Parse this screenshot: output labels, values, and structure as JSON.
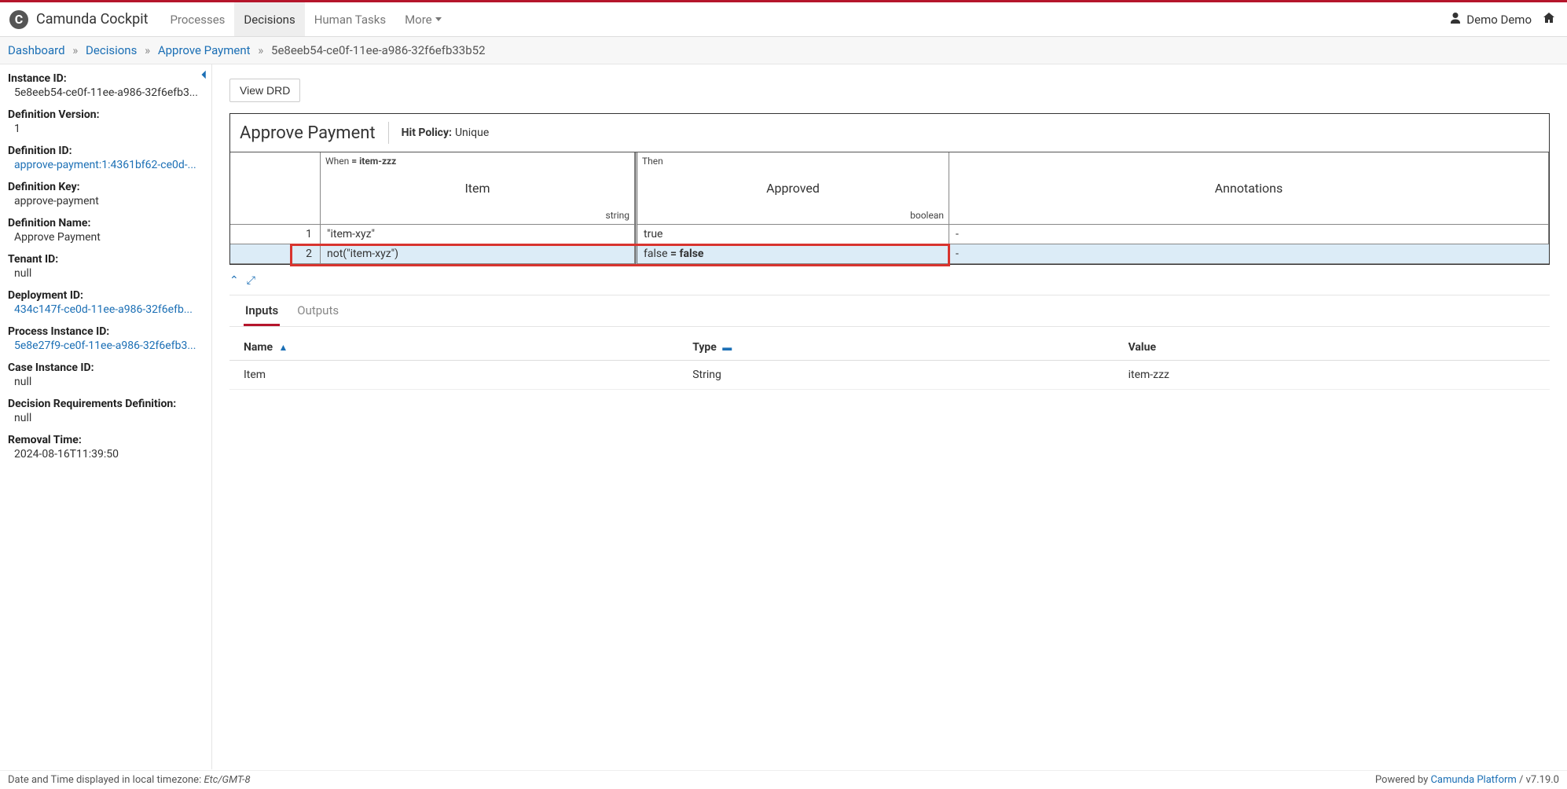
{
  "header": {
    "app_title": "Camunda Cockpit",
    "nav": [
      "Processes",
      "Decisions",
      "Human Tasks",
      "More"
    ],
    "active_nav_index": 1,
    "user_name": "Demo Demo"
  },
  "breadcrumb": {
    "items": [
      {
        "label": "Dashboard",
        "link": true
      },
      {
        "label": "Decisions",
        "link": true
      },
      {
        "label": "Approve Payment",
        "link": true
      },
      {
        "label": "5e8eeb54-ce0f-11ee-a986-32f6efb33b52",
        "link": false
      }
    ]
  },
  "sidebar": {
    "instance_id": {
      "label": "Instance ID:",
      "value": "5e8eeb54-ce0f-11ee-a986-32f6efb3..."
    },
    "definition_version": {
      "label": "Definition Version:",
      "value": "1"
    },
    "definition_id": {
      "label": "Definition ID:",
      "value": "approve-payment:1:4361bf62-ce0d-..."
    },
    "definition_key": {
      "label": "Definition Key:",
      "value": "approve-payment"
    },
    "definition_name": {
      "label": "Definition Name:",
      "value": "Approve Payment"
    },
    "tenant_id": {
      "label": "Tenant ID:",
      "value": "null"
    },
    "deployment_id": {
      "label": "Deployment ID:",
      "value": "434c147f-ce0d-11ee-a986-32f6efb..."
    },
    "process_instance_id": {
      "label": "Process Instance ID:",
      "value": "5e8e27f9-ce0f-11ee-a986-32f6efb3..."
    },
    "case_instance_id": {
      "label": "Case Instance ID:",
      "value": "null"
    },
    "drd": {
      "label": "Decision Requirements Definition:",
      "value": "null"
    },
    "removal_time": {
      "label": "Removal Time:",
      "value": "2024-08-16T11:39:50"
    }
  },
  "actions": {
    "view_drd": "View DRD"
  },
  "dmn": {
    "title": "Approve Payment",
    "hit_policy_label": "Hit Policy:",
    "hit_policy_value": "Unique",
    "columns": {
      "when_label": "When",
      "when_expr": "= item-zzz",
      "input_name": "Item",
      "input_type": "string",
      "then_label": "Then",
      "output_name": "Approved",
      "output_type": "boolean",
      "annotations": "Annotations"
    },
    "rules": [
      {
        "num": "1",
        "input": "\"item-xyz\"",
        "output": "true",
        "annotation": "-",
        "highlighted": false
      },
      {
        "num": "2",
        "input": "not(\"item-xyz\")",
        "output_prefix": "false ",
        "output_bold": "= false",
        "annotation": "-",
        "highlighted": true
      }
    ]
  },
  "tabs": {
    "items": [
      "Inputs",
      "Outputs"
    ],
    "active_index": 0
  },
  "table": {
    "headers": {
      "name": "Name",
      "type": "Type",
      "value": "Value"
    },
    "rows": [
      {
        "name": "Item",
        "type": "String",
        "value": "item-zzz"
      }
    ]
  },
  "footer": {
    "tz_label": "Date and Time displayed in local timezone: ",
    "tz": "Etc/GMT-8",
    "powered_by": "Powered by ",
    "platform": "Camunda Platform",
    "version": " / v7.19.0"
  }
}
